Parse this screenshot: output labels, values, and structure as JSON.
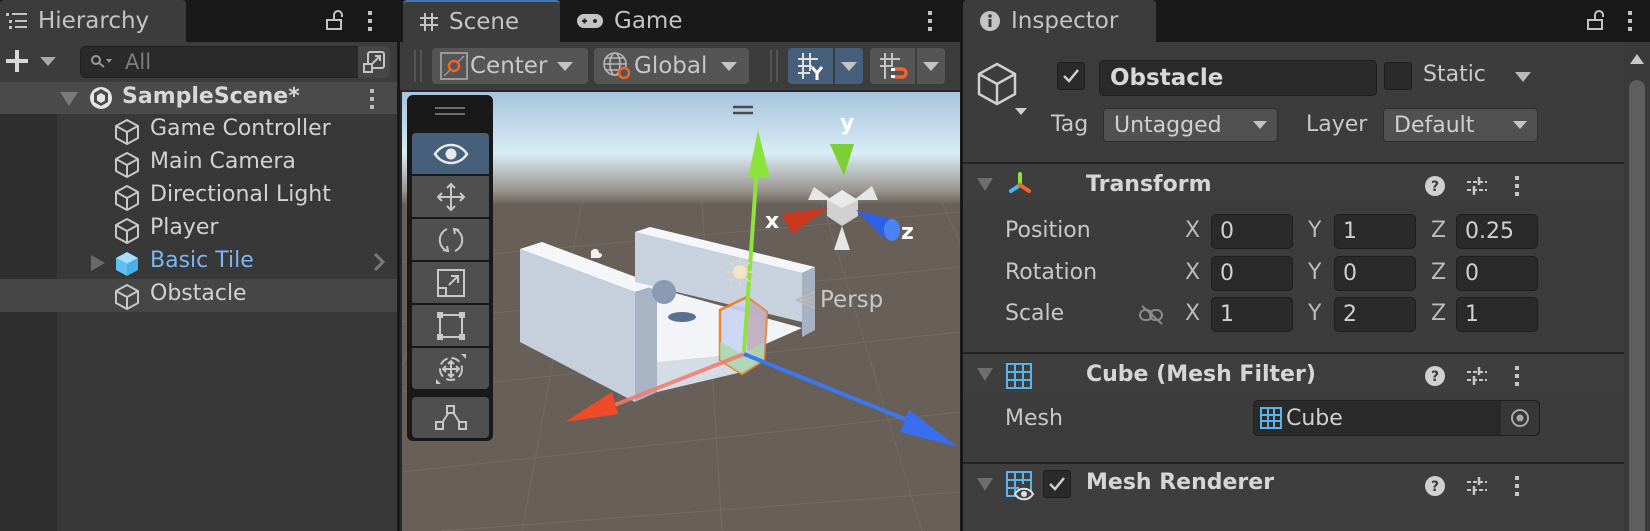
{
  "hierarchy": {
    "tab_label": "Hierarchy",
    "search_placeholder": "All",
    "scene_name": "SampleScene*",
    "items": [
      {
        "label": "Game Controller",
        "type": "gameobject"
      },
      {
        "label": "Main Camera",
        "type": "gameobject"
      },
      {
        "label": "Directional Light",
        "type": "gameobject"
      },
      {
        "label": "Player",
        "type": "gameobject"
      },
      {
        "label": "Basic Tile",
        "type": "prefab",
        "expandable": true
      },
      {
        "label": "Obstacle",
        "type": "gameobject",
        "selected": true
      }
    ]
  },
  "scene_view": {
    "tabs": [
      {
        "label": "Scene",
        "icon": "grid-icon",
        "active": true
      },
      {
        "label": "Game",
        "icon": "gamepad-icon",
        "active": false
      }
    ],
    "toolbar": {
      "pivot_mode": "Center",
      "pivot_rotation": "Global"
    },
    "tools": [
      "view-tool",
      "move-tool",
      "rotate-tool",
      "scale-tool",
      "rect-tool",
      "transform-tool",
      "custom-editor-tool"
    ],
    "active_tool": "view-tool",
    "gizmo_axes": {
      "x": "x",
      "y": "y",
      "z": "z"
    },
    "projection_label": "Persp"
  },
  "inspector": {
    "tab_label": "Inspector",
    "object": {
      "active": true,
      "name": "Obstacle",
      "static_label": "Static",
      "static": false,
      "tag_label": "Tag",
      "tag": "Untagged",
      "layer_label": "Layer",
      "layer": "Default"
    },
    "components": {
      "transform": {
        "title": "Transform",
        "position_label": "Position",
        "rotation_label": "Rotation",
        "scale_label": "Scale",
        "position": {
          "x": "0",
          "y": "1",
          "z": "0.25"
        },
        "rotation": {
          "x": "0",
          "y": "0",
          "z": "0"
        },
        "scale": {
          "x": "1",
          "y": "2",
          "z": "1"
        }
      },
      "mesh_filter": {
        "title": "Cube (Mesh Filter)",
        "mesh_label": "Mesh",
        "mesh_value": "Cube"
      },
      "mesh_renderer": {
        "title": "Mesh Renderer",
        "enabled": true
      }
    },
    "axis_labels": {
      "x": "X",
      "y": "Y",
      "z": "Z"
    }
  },
  "colors": {
    "accent_blue": "#46607c",
    "prefab_text": "#7cb6f2",
    "axis_x": "#e8452c",
    "axis_y": "#8ee23c",
    "axis_z": "#3a78f0",
    "selection_outline": "#f07818"
  }
}
